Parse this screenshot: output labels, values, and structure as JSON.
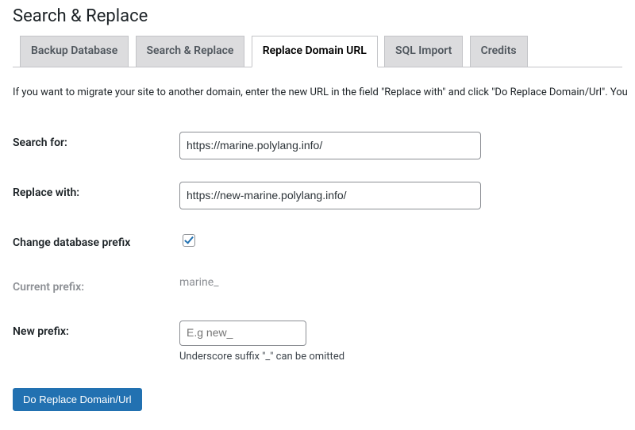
{
  "page_title": "Search & Replace",
  "tabs": [
    {
      "label": "Backup Database",
      "active": false
    },
    {
      "label": "Search & Replace",
      "active": false
    },
    {
      "label": "Replace Domain URL",
      "active": true
    },
    {
      "label": "SQL Import",
      "active": false
    },
    {
      "label": "Credits",
      "active": false
    }
  ],
  "description": "If you want to migrate your site to another domain, enter the new URL in the field \"Replace with\" and click \"Do Replace Domain/Url\". You",
  "form": {
    "search_for": {
      "label": "Search for:",
      "value": "https://marine.polylang.info/"
    },
    "replace_with": {
      "label": "Replace with:",
      "value": "https://new-marine.polylang.info/"
    },
    "change_prefix": {
      "label": "Change database prefix",
      "checked": true
    },
    "current_prefix": {
      "label": "Current prefix:",
      "value": "marine_"
    },
    "new_prefix": {
      "label": "New prefix:",
      "placeholder": "E.g new_",
      "help": "Underscore suffix \"_\" can be omitted"
    },
    "submit_label": "Do Replace Domain/Url"
  }
}
